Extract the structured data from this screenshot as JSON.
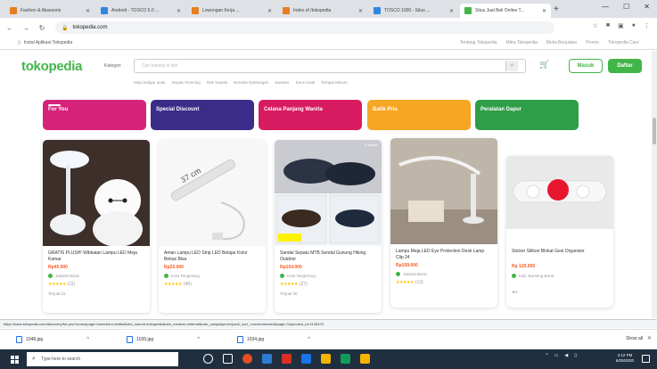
{
  "browser": {
    "tabs": [
      {
        "label": "Fashion & Aksesoris",
        "color": "#e67e22"
      },
      {
        "label": "Android - TOSCO 5.0 ...",
        "color": "#2e86de"
      },
      {
        "label": "Lowongan Kerja ...",
        "color": "#e67e22"
      },
      {
        "label": "Index of /tokopedia",
        "color": "#e67e22"
      },
      {
        "label": "TOSCO 1000 - Situs ...",
        "color": "#2e86de"
      },
      {
        "label": "Situs Jual Beli Online T...",
        "color": "#42b549"
      }
    ],
    "active_tab": 5,
    "url": "tokopedia.com",
    "bookmark_left": "Instal Aplikasi Tokopedia",
    "bookmark_right": [
      "Tentang Tokopedia",
      "Mitra Tokopedia",
      "Mulai Berjualan",
      "Promo",
      "Tokopedia Care"
    ]
  },
  "header": {
    "logo": "tokopedia",
    "kategori": "Kategori",
    "search_placeholder": "Cari barang di sini",
    "masuk": "Masuk",
    "daftar": "Daftar",
    "suggestions": [
      "Meja belajar anak",
      "Sepatu Running",
      "Rak Sepatu",
      "Boneka Gantungan",
      "Sweater",
      "Kaos Anak",
      "Tempat Minum"
    ]
  },
  "banners": [
    {
      "label": "For You",
      "color": "#d6237a"
    },
    {
      "label": "Special Discount",
      "color": "#3c2c8a"
    },
    {
      "label": "Celana Panjang Wanita",
      "color": "#d81b60"
    },
    {
      "label": "Batik Pria",
      "color": "#f5a623"
    },
    {
      "label": "Peralatan Dapur",
      "color": "#2e9e48"
    }
  ],
  "products": [
    {
      "name": "GRATIS PLUSH! Wibkatan Lampu LED Meja Kamar",
      "price": "Rp45.000",
      "shop": "Jakarta Barat",
      "stars": "★★★★★",
      "count": "(11)",
      "sold": "Terjual 15"
    },
    {
      "name": "Aman Lampu LED Strip LED Belajar Kolor Bebas Bisa",
      "price": "Rp25.000",
      "shop": "Kota Tangerang",
      "stars": "★★★★★",
      "count": "(40)",
      "sold": ""
    },
    {
      "name": "Sandal Sepatu MTB Sendal Gunung Hiking Outdoor",
      "price": "Rp154.000",
      "shop": "Kota Tangerang",
      "stars": "★★★★★",
      "count": "(27)",
      "sold": "Terjual 30"
    },
    {
      "name": "Lampu Meja LED Eye Protection Desk Lamp Clip 24",
      "price": "Rp159.000",
      "shop": "Jakarta Barat",
      "stars": "★★★★★",
      "count": "(13)",
      "sold": ""
    },
    {
      "name": "Sticker Silikon Blokat Gesi Organizer",
      "price": "Rp 120.000",
      "shop": "Kab. Banteng Barat",
      "stars": "",
      "count": "",
      "sold": "★5"
    }
  ],
  "p3_overlay": "4 Varian",
  "p2_img_label": "37 cm",
  "status_url": "https://www.tokopedia.com/discovery/for-you?sourcepage=home&src=hotlist&utm_source=tokopedia&utm_medium=internal&utm_campaign=foryou&_sort_=recommended&page=1&product_id=1128470",
  "downloads": [
    {
      "name": "1048.jpg"
    },
    {
      "name": "1035.jpg"
    },
    {
      "name": "1034.jpg"
    }
  ],
  "show_all": "Show all",
  "taskbar": {
    "search_placeholder": "Type here to search",
    "time": "4:12 PM",
    "date": "6/25/2020"
  }
}
